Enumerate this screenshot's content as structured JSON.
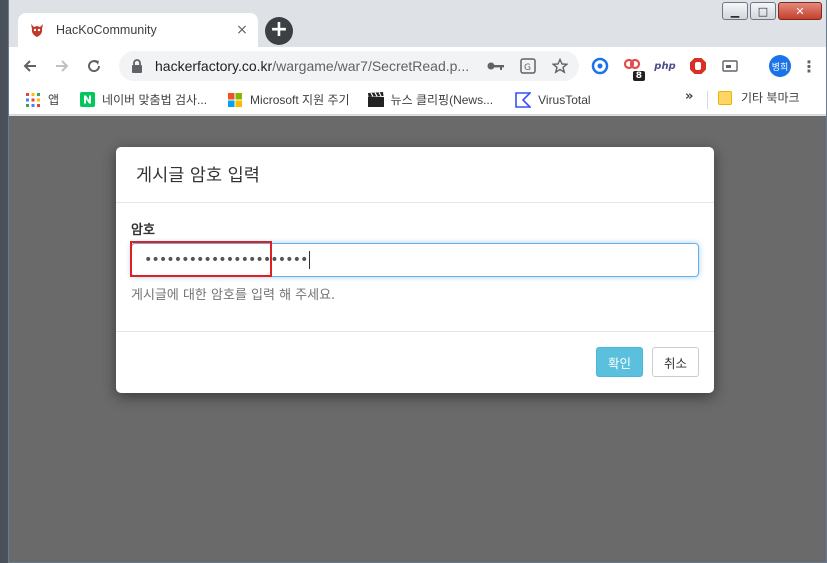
{
  "tab": {
    "title": "HacKoCommunity",
    "close_glyph": "×"
  },
  "newtab_glyph": "+",
  "window_controls": {
    "minimize": "▁",
    "maximize": "□",
    "close": "✕"
  },
  "toolbar": {
    "url_domain": "hackerfactory.co.kr",
    "url_path": "/wargame/war7/SecretRead.p...",
    "profile_label": "병희",
    "badge_count": "8",
    "php_label": "php"
  },
  "bookmarks": {
    "items": [
      {
        "label": "앱",
        "icon": "apps-grid-icon"
      },
      {
        "label": "네이버 맞춤법 검사...",
        "icon": "naver-icon"
      },
      {
        "label": "Microsoft 지원 주기",
        "icon": "microsoft-icon"
      },
      {
        "label": "뉴스 클리핑(News...",
        "icon": "clapper-icon"
      },
      {
        "label": "VirusTotal",
        "icon": "virustotal-icon"
      }
    ],
    "overflow": "»",
    "other_label": "기타 북마크"
  },
  "modal": {
    "title": "게시글 암호 입력",
    "field_label": "암호",
    "password_value": "••••••••••••••••••••••",
    "help_text": "게시글에 대한 암호를 입력 해 주세요.",
    "confirm_label": "확인",
    "cancel_label": "취소"
  },
  "colors": {
    "accent_focus": "#66afe9",
    "primary_button": "#5bc0de",
    "highlight_box": "#e02020",
    "overlay": "#6a6a6a"
  }
}
